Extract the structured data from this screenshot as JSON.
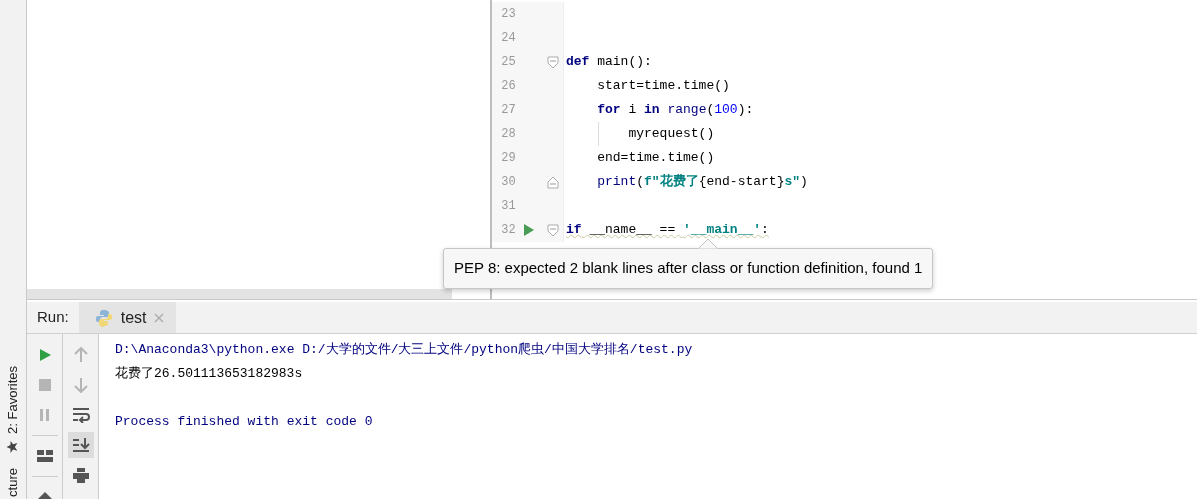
{
  "side_strip": {
    "tabs": [
      {
        "label": "2: Favorites",
        "kind": "favorites"
      },
      {
        "label": "cture",
        "kind": "plain"
      }
    ]
  },
  "editor": {
    "lines": [
      {
        "number": "23"
      },
      {
        "number": "24"
      },
      {
        "number": "25",
        "fold_start": true,
        "tokens": [
          {
            "kind": "kw",
            "text": "def"
          },
          {
            "kind": "plain",
            "text": " main():"
          }
        ]
      },
      {
        "number": "26",
        "tokens": [
          {
            "kind": "plain",
            "text": "    start=time.time()"
          }
        ]
      },
      {
        "number": "27",
        "tokens": [
          {
            "kind": "kw",
            "text": "    for"
          },
          {
            "kind": "plain",
            "text": " i "
          },
          {
            "kind": "kw",
            "text": "in"
          },
          {
            "kind": "builtin",
            "text": " range"
          },
          {
            "kind": "plain",
            "text": "("
          },
          {
            "kind": "num",
            "text": "100"
          },
          {
            "kind": "plain",
            "text": "):"
          }
        ]
      },
      {
        "number": "28",
        "guide": true,
        "tokens": [
          {
            "kind": "plain",
            "text": "        myrequest()"
          }
        ]
      },
      {
        "number": "29",
        "tokens": [
          {
            "kind": "plain",
            "text": "    end=time.time()"
          }
        ]
      },
      {
        "number": "30",
        "fold_end": true,
        "tokens": [
          {
            "kind": "builtin",
            "text": "    print"
          },
          {
            "kind": "plain",
            "text": "("
          },
          {
            "kind": "str",
            "text": "f\"花费了"
          },
          {
            "kind": "plain",
            "text": "{end-start}"
          },
          {
            "kind": "str",
            "text": "s\""
          },
          {
            "kind": "plain",
            "text": ")"
          }
        ]
      },
      {
        "number": "31"
      },
      {
        "number": "32",
        "fold_start": true,
        "run": true,
        "warning": true,
        "tokens": [
          {
            "kind": "kw",
            "text": "if"
          },
          {
            "kind": "plain",
            "text": " __name__ == "
          },
          {
            "kind": "str",
            "text": "'__main__'"
          },
          {
            "kind": "plain",
            "text": ":"
          }
        ]
      }
    ],
    "tooltip": {
      "text": "PEP 8: expected 2 blank lines after class or function definition, found 1"
    }
  },
  "run": {
    "label": "Run:",
    "tabs": [
      {
        "label": "test",
        "selected": true
      }
    ],
    "toolbar": [
      [
        {
          "kind": "run",
          "disabled": false
        },
        {
          "kind": "stop",
          "disabled": true
        },
        {
          "kind": "pause",
          "disabled": true
        },
        {
          "kind": "layout",
          "disabled": false
        },
        {
          "kind": "pin",
          "disabled": false
        }
      ],
      [
        {
          "kind": "up",
          "disabled": true
        },
        {
          "kind": "down",
          "disabled": true
        },
        {
          "kind": "wrap",
          "disabled": false
        },
        {
          "kind": "scroll-end",
          "disabled": false,
          "selected": true
        },
        {
          "kind": "print",
          "disabled": false
        }
      ]
    ],
    "console": [
      {
        "kind": "command",
        "text": "D:\\Anaconda3\\python.exe D:/大学的文件/大三上文件/python爬虫/中国大学排名/test.py"
      },
      {
        "kind": "output",
        "text": "花费了26.501113653182983s"
      },
      {
        "kind": "blank"
      },
      {
        "kind": "system",
        "text": "Process finished with exit code 0"
      }
    ]
  }
}
